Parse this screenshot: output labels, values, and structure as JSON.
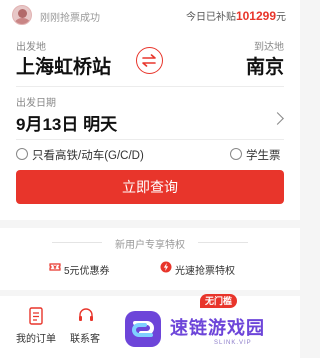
{
  "ticker": {
    "left_text": "刚刚抢票成功",
    "right_prefix": "今日已补贴",
    "right_amount": "101299",
    "right_suffix": "元"
  },
  "route": {
    "from_label": "出发地",
    "from_city": "上海虹桥站",
    "to_label": "到达地",
    "to_city": "南京"
  },
  "date": {
    "label": "出发日期",
    "value": "9月13日 明天"
  },
  "options": {
    "high_speed_only": "只看高铁/动车(G/C/D)",
    "student_ticket": "学生票"
  },
  "query_button": "立即查询",
  "promo": {
    "title": "新用户专享特权",
    "coupon": "5元优惠券",
    "fast_grab": "光速抢票特权"
  },
  "bottom": {
    "my_orders": "我的订单",
    "contact_service": "联系客",
    "badge": "无门槛"
  },
  "watermark": {
    "title": "速链游戏园",
    "sub": "SLINK.VIP"
  },
  "colors": {
    "accent": "#e8352b",
    "watermark": "#6d45d9"
  }
}
